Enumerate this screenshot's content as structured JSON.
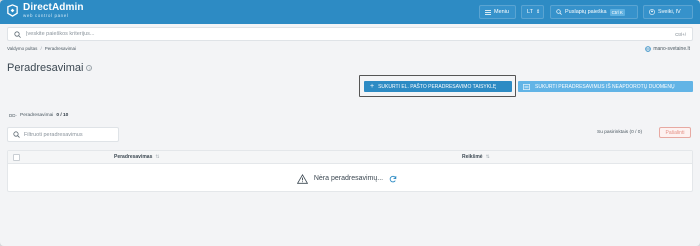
{
  "app": {
    "name": "DirectAdmin",
    "tagline": "web control panel"
  },
  "topbar": {
    "menu_label": "Meniu",
    "language": "LT",
    "quick_search_label": "Puslapių paieška",
    "quick_search_shortcut": "Ctrl K",
    "user_label": "Sveiki, lV"
  },
  "search": {
    "placeholder": "Įveskite paieškos kriterijus...",
    "shortcut": "Ctrl+/"
  },
  "breadcrumb": {
    "items": [
      "Valdymo pultas",
      "Peradresavimai"
    ]
  },
  "domain": "mano-svetaine.lt",
  "page_title": "Peradresavimai",
  "actions": {
    "create_template": "SUKURTI EL. PAŠTO PERADRESAVIMO TAISYKLĘ",
    "create_from_unused": "SUKURTI PERADRESAVIMUS IŠ NEAPDOROTŲ DUOMENŲ"
  },
  "counter": {
    "label": "Peradresavimai",
    "value": "0 / 10"
  },
  "filter": {
    "placeholder": "Filtruoti peradresavimus"
  },
  "selection": {
    "label": "Su pasirinktais (0 / 0)",
    "delete_label": "Pašalinti"
  },
  "table": {
    "columns": [
      "Peradresavimas",
      "Reikšmė"
    ],
    "empty_text": "Nėra peradresavimų..."
  },
  "colors": {
    "brand": "#2d8bc4",
    "accent_light": "#62b4e6",
    "danger": "#e49186"
  }
}
